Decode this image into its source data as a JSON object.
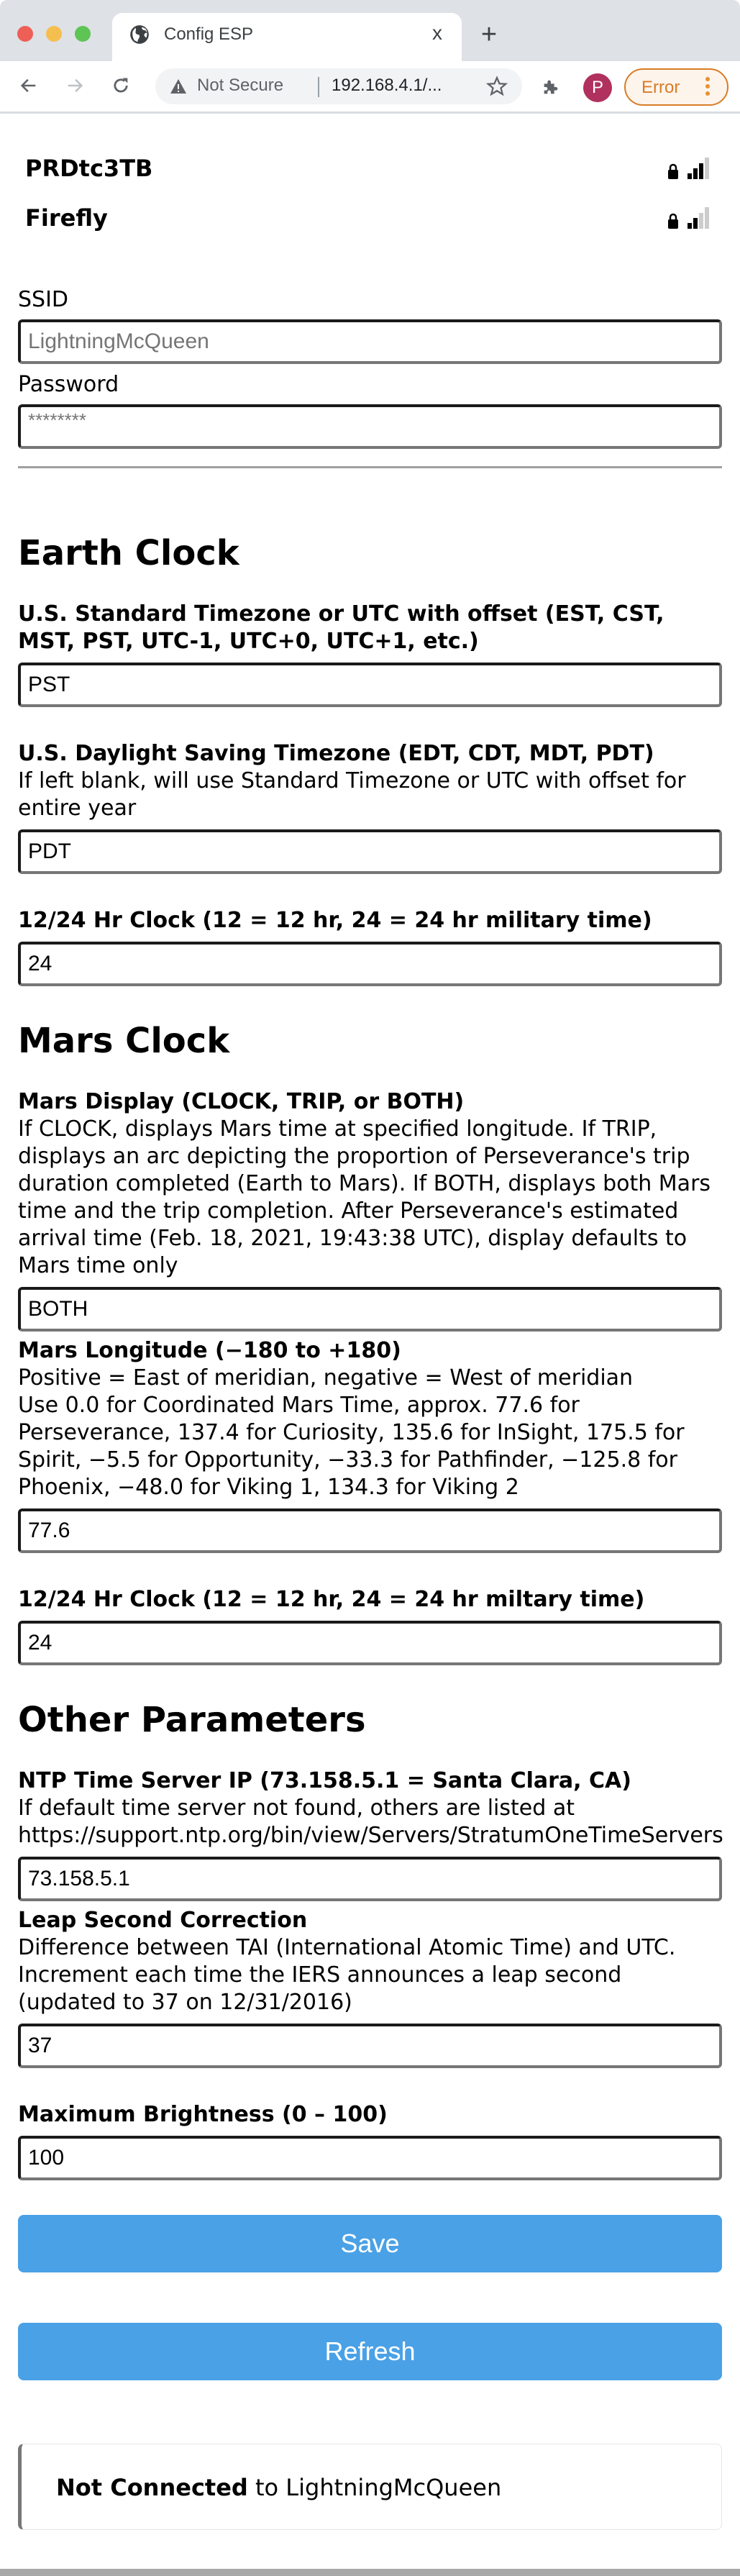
{
  "browser": {
    "tab_title": "Config ESP",
    "tab_close": "x",
    "new_tab": "+",
    "security_label": "Not Secure",
    "url": "192.168.4.1/...",
    "profile_initial": "P",
    "error_label": "Error"
  },
  "networks": [
    {
      "name": "PRDtc3TB",
      "secured": true,
      "signal_bars": 3,
      "signal_max": 4
    },
    {
      "name": "Firefly",
      "secured": true,
      "signal_bars": 2,
      "signal_max": 4
    }
  ],
  "wifi": {
    "ssid_label": "SSID",
    "ssid_placeholder": "LightningMcQueen",
    "password_label": "Password",
    "password_placeholder": "********"
  },
  "earth_clock": {
    "heading": "Earth Clock",
    "standard_tz": {
      "label": "U.S. Standard Timezone or UTC with offset (EST, CST, MST, PST, UTC-1, UTC+0, UTC+1, etc.)",
      "value": "PST"
    },
    "daylight_tz": {
      "label": "U.S. Daylight Saving Timezone (EDT, CDT, MDT, PDT)",
      "help": "If left blank, will use Standard Timezone or UTC with offset for entire year",
      "value": "PDT"
    },
    "hour_format": {
      "label": "12/24 Hr Clock (12 = 12 hr, 24 = 24 hr military time)",
      "value": "24"
    }
  },
  "mars_clock": {
    "heading": "Mars Clock",
    "display": {
      "label": "Mars Display (CLOCK, TRIP, or BOTH)",
      "help": "If CLOCK, displays Mars time at specified longitude. If TRIP, displays an arc depicting the proportion of Perseverance's trip duration completed (Earth to Mars). If BOTH, displays both Mars time and the trip completion. After Perseverance's estimated arrival time (Feb. 18, 2021, 19:43:38 UTC), display defaults to Mars time only",
      "value": "BOTH"
    },
    "longitude": {
      "label": "Mars Longitude (−180 to +180)",
      "help_line1": "Positive = East of meridian, negative = West of meridian",
      "help_line2": "Use 0.0 for Coordinated Mars Time, approx. 77.6 for Perseverance, 137.4 for Curiosity, 135.6 for InSight, 175.5 for Spirit, −5.5 for Opportunity, −33.3 for Pathfinder, −125.8 for Phoenix, −48.0 for Viking 1, 134.3 for Viking 2",
      "value": "77.6"
    },
    "hour_format": {
      "label": "12/24 Hr Clock (12 = 12 hr, 24 = 24 hr miltary time)",
      "value": "24"
    }
  },
  "other": {
    "heading": "Other Parameters",
    "ntp": {
      "label": "NTP Time Server IP (73.158.5.1 = Santa Clara, CA)",
      "help_line1": "If default time server not found, others are listed at",
      "help_line2": "https://support.ntp.org/bin/view/Servers/StratumOneTimeServers",
      "value": "73.158.5.1"
    },
    "leap_second": {
      "label": "Leap Second Correction",
      "help": "Difference between TAI (International Atomic Time) and UTC. Increment each time the IERS announces a leap second (updated to 37 on 12/31/2016)",
      "value": "37"
    },
    "brightness": {
      "label": "Maximum Brightness (0 – 100)",
      "value": "100"
    }
  },
  "actions": {
    "save_label": "Save",
    "refresh_label": "Refresh"
  },
  "status": {
    "state": "Not Connected",
    "connector": " to ",
    "network": "LightningMcQueen"
  },
  "colors": {
    "button": "#4aa1e6",
    "error_chip": "#d97c25",
    "avatar": "#b0315e"
  }
}
